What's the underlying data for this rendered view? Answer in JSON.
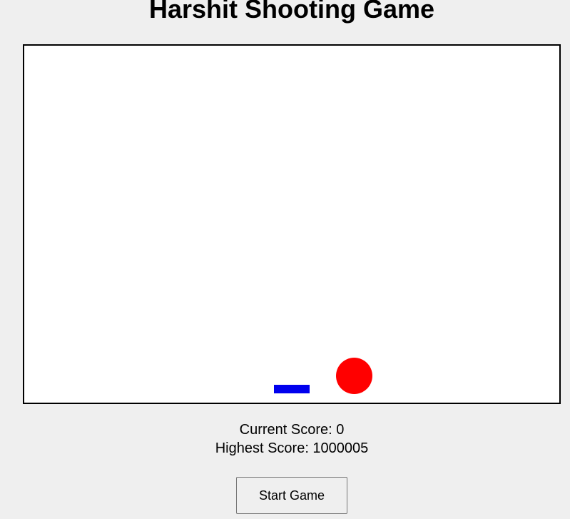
{
  "title": "Harshit Shooting Game",
  "game": {
    "player_color": "#0000ee",
    "target_color": "#ff0000",
    "canvas_background": "#ffffff"
  },
  "scores": {
    "current": "Current Score: 0",
    "highest": "Highest Score: 1000005"
  },
  "controls": {
    "start_label": "Start Game"
  }
}
